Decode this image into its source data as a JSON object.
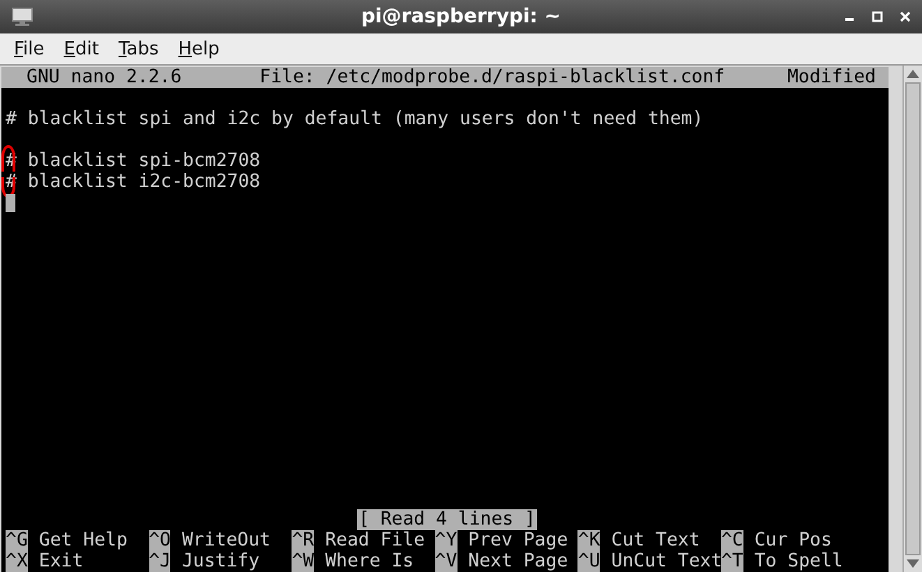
{
  "window": {
    "title": "pi@raspberrypi: ~"
  },
  "menu": [
    {
      "label": "File"
    },
    {
      "label": "Edit"
    },
    {
      "label": "Tabs"
    },
    {
      "label": "Help"
    }
  ],
  "nano": {
    "version": "GNU nano 2.2.6",
    "file": "File: /etc/modprobe.d/raspi-blacklist.conf",
    "state": "Modified"
  },
  "lines": [
    {
      "text": "# blacklist spi and i2c by default (many users don't need them)",
      "preceded_by_blank": false,
      "circled": false
    },
    {
      "text": "# blacklist spi-bcm2708",
      "preceded_by_blank": true,
      "circled": true
    },
    {
      "text": "# blacklist i2c-bcm2708",
      "preceded_by_blank": false,
      "circled": true
    }
  ],
  "cursor": {
    "visible": true
  },
  "status": "[ Read 4 lines ]",
  "shortcut_rows": [
    [
      {
        "key": "^G",
        "label": "Get Help"
      },
      {
        "key": "^O",
        "label": "WriteOut"
      },
      {
        "key": "^R",
        "label": "Read File"
      },
      {
        "key": "^Y",
        "label": "Prev Page"
      },
      {
        "key": "^K",
        "label": "Cut Text"
      },
      {
        "key": "^C",
        "label": "Cur Pos"
      }
    ],
    [
      {
        "key": "^X",
        "label": "Exit"
      },
      {
        "key": "^J",
        "label": "Justify"
      },
      {
        "key": "^W",
        "label": "Where Is"
      },
      {
        "key": "^V",
        "label": "Next Page"
      },
      {
        "key": "^U",
        "label": "UnCut Text"
      },
      {
        "key": "^T",
        "label": "To Spell"
      }
    ]
  ]
}
